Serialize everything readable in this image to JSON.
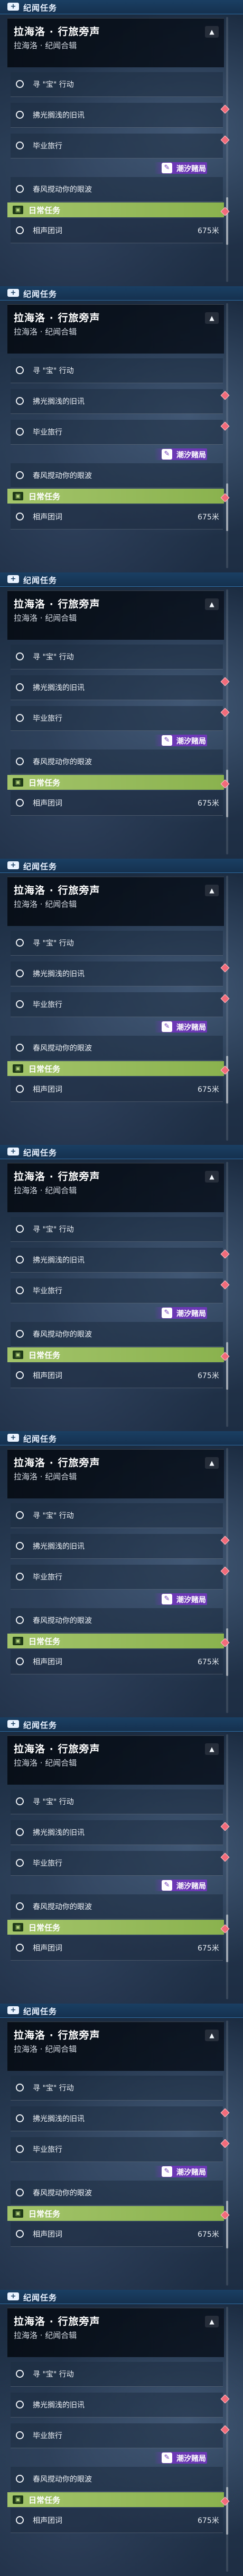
{
  "header": {
    "title": "纪闻任务",
    "icon": "+"
  },
  "quest": {
    "title": "拉海洛 · 行旅旁声",
    "subtitle": "拉海洛 · 纪闻合辑",
    "collapse_icon": "▲",
    "items": [
      {
        "label": "寻 \"宝\" 行动"
      },
      {
        "label": "拂光搁浅的旧讯"
      },
      {
        "label": "毕业旅行"
      },
      {
        "label": "春风搅动你的眼波"
      }
    ]
  },
  "special_tag": {
    "label": "潮汐赌局",
    "icon": "✎"
  },
  "daily": {
    "title": "日常任务",
    "icon": "▣",
    "items": [
      {
        "label": "相声团词",
        "distance": "675米"
      }
    ]
  },
  "colors": {
    "accent": "#2f6ea5",
    "daily": "#a3c46a",
    "special": "#6e37b9",
    "marker": "#f26b7a"
  }
}
